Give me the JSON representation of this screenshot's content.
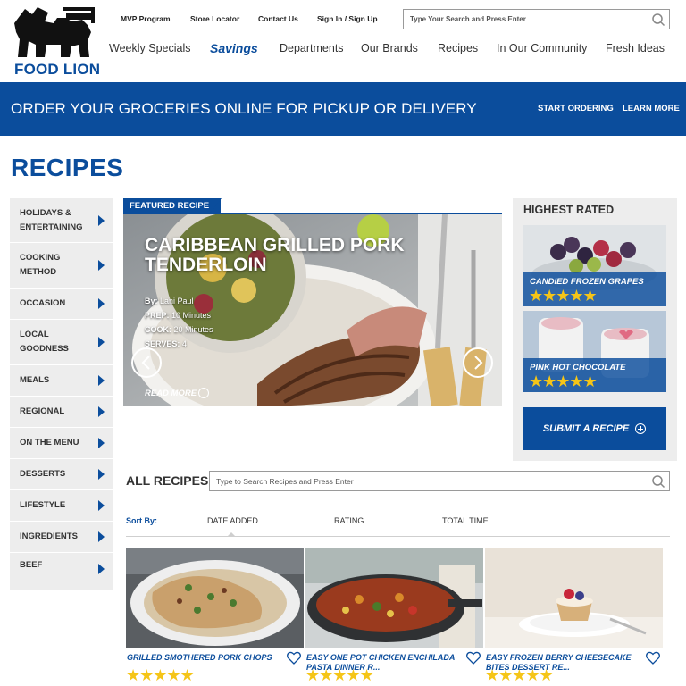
{
  "brand": {
    "name": "FOOD LION",
    "color": "#0b4d9c"
  },
  "utility_links": [
    "MVP Program",
    "Store Locator",
    "Contact Us",
    "Sign In / Sign Up"
  ],
  "top_search": {
    "placeholder": "Type Your Search and Press Enter",
    "icon": "search-icon"
  },
  "main_nav": [
    "Weekly Specials",
    "Savings",
    "Departments",
    "Our Brands",
    "Recipes",
    "In Our Community",
    "Fresh Ideas"
  ],
  "main_nav_active": "Savings",
  "banner": {
    "text": "ORDER YOUR GROCERIES ONLINE FOR PICKUP OR DELIVERY",
    "link1": "START ORDERING",
    "link2": "LEARN MORE"
  },
  "page_title": "RECIPES",
  "sidebar": [
    "HOLIDAYS & ENTERTAINING",
    "COOKING METHOD",
    "OCCASION",
    "LOCAL GOODNESS",
    "MEALS",
    "REGIONAL",
    "ON THE MENU",
    "DESSERTS",
    "LIFESTYLE",
    "INGREDIENTS",
    "BEEF"
  ],
  "featured": {
    "tab": "FEATURED RECIPES",
    "title": "CARIBBEAN GRILLED PORK TENDERLOIN",
    "by_label": "By:",
    "by": "Lani Paul",
    "prep_label": "PREP:",
    "prep": "10 Minutes",
    "cook_label": "COOK:",
    "cook": "20 Minutes",
    "serves_label": "SERVES:",
    "serves": "4",
    "read_more": "READ MORE"
  },
  "highest_rated": {
    "title": "HIGHEST RATED",
    "items": [
      {
        "name": "CANDIED FROZEN GRAPES",
        "stars": "★★★★★",
        "rating": 5
      },
      {
        "name": "PINK HOT CHOCOLATE",
        "stars": "★★★★★",
        "rating": 5
      }
    ],
    "submit": "SUBMIT A RECIPE"
  },
  "all_recipes": {
    "title": "ALL RECIPES",
    "search_placeholder": "Type to Search Recipes and Press Enter",
    "sort_label": "Sort By:",
    "sort_options": [
      "DATE ADDED",
      "RATING",
      "TOTAL TIME"
    ],
    "cards": [
      {
        "title": "GRILLED SMOTHERED PORK CHOPS",
        "stars": "★★★★★",
        "rating": 5
      },
      {
        "title": "EASY ONE POT CHICKEN ENCHILADA PASTA DINNER R...",
        "stars": "★★★★★",
        "rating": 5
      },
      {
        "title": "EASY FROZEN BERRY CHEESECAKE BITES DESSERT RE...",
        "stars": "★★★★★",
        "rating": 5
      }
    ]
  },
  "colors": {
    "primary": "#0b4d9c",
    "star": "#f5c518",
    "panel": "#ededed"
  }
}
